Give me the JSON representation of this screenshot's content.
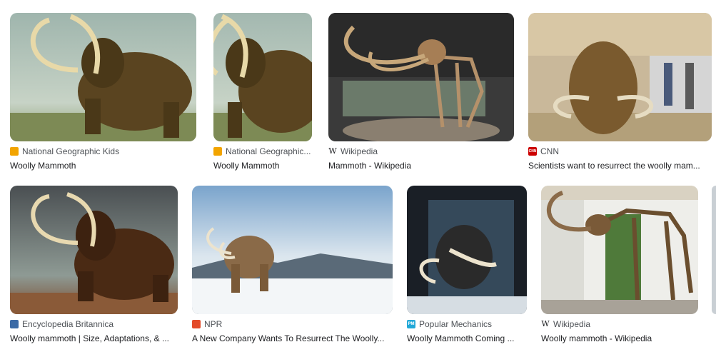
{
  "results": [
    {
      "source": "National Geographic Kids",
      "title": "Woolly Mammoth",
      "favicon": "natgeo-kids-icon",
      "favicon_color": "#f2a400"
    },
    {
      "source": "National Geographic...",
      "title": "Woolly Mammoth",
      "favicon": "natgeo-kids-icon",
      "favicon_color": "#f2a400"
    },
    {
      "source": "Wikipedia",
      "title": "Mammoth - Wikipedia",
      "favicon": "wikipedia-icon",
      "favicon_glyph": "W"
    },
    {
      "source": "CNN",
      "title": "Scientists want to resurrect the woolly mam...",
      "favicon": "cnn-icon",
      "favicon_color": "#cc0000",
      "favicon_glyph": "CNN"
    },
    {
      "source": "Encyclopedia Britannica",
      "title": "Woolly mammoth | Size, Adaptations, & ...",
      "favicon": "britannica-icon",
      "favicon_color": "#3b6aa6"
    },
    {
      "source": "NPR",
      "title": "A New Company Wants To Resurrect The Woolly...",
      "favicon": "npr-icon",
      "favicon_color": "#e34b2a"
    },
    {
      "source": "Popular Mechanics",
      "title": "Woolly Mammoth Coming ...",
      "favicon": "popular-mechanics-icon",
      "favicon_color": "#20a8d8",
      "favicon_glyph": "PM"
    },
    {
      "source": "Wikipedia",
      "title": "Woolly mammoth - Wikipedia",
      "favicon": "wikipedia-icon",
      "favicon_glyph": "W"
    }
  ]
}
